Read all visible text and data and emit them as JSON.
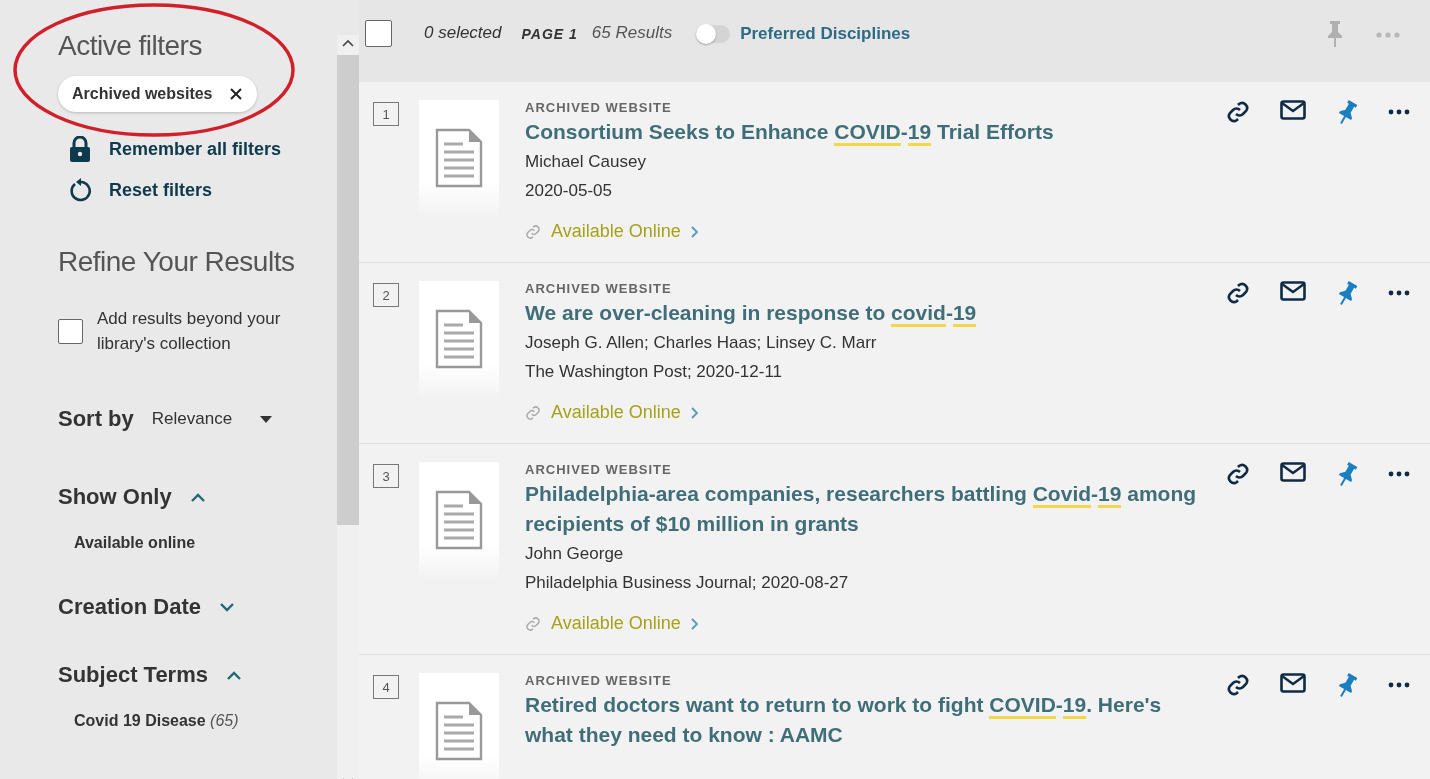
{
  "annotation": {
    "kind": "ellipse",
    "color": "#d0202a"
  },
  "sidebar": {
    "active_filters_title": "Active filters",
    "active_filters": [
      {
        "label": "Archived websites"
      }
    ],
    "remember_filters": "Remember all filters",
    "reset_filters": "Reset filters",
    "refine_title": "Refine Your Results",
    "beyond_collection": {
      "label": "Add results beyond your library's collection",
      "checked": false
    },
    "sort": {
      "label": "Sort by",
      "value": "Relevance"
    },
    "sections": [
      {
        "title": "Show Only",
        "expanded": true,
        "items": [
          {
            "label": "Available online"
          }
        ]
      },
      {
        "title": "Creation Date",
        "expanded": false
      },
      {
        "title": "Subject Terms",
        "expanded": true,
        "items": [
          {
            "label": "Covid 19 Disease",
            "count": "(65)"
          }
        ]
      }
    ]
  },
  "toolbar": {
    "select_all_checked": false,
    "selected": "0 selected",
    "page": "PAGE 1",
    "results": "65 Results",
    "preferred_disciplines": {
      "label": "Preferred Disciplines",
      "on": false
    }
  },
  "results": [
    {
      "number": "1",
      "type": "ARCHIVED WEBSITE",
      "title": [
        {
          "text": "Consortium Seeks to Enhance ",
          "highlight": false
        },
        {
          "text": "COVID",
          "highlight": true
        },
        {
          "text": "-",
          "highlight": false
        },
        {
          "text": "19",
          "highlight": true
        },
        {
          "text": " Trial Efforts",
          "highlight": false
        }
      ],
      "lines": [
        "Michael Causey",
        "2020-05-05"
      ],
      "availability": "Available Online",
      "pinned": true
    },
    {
      "number": "2",
      "type": "ARCHIVED WEBSITE",
      "title": [
        {
          "text": "We are over-cleaning in response to ",
          "highlight": false
        },
        {
          "text": "covid",
          "highlight": true
        },
        {
          "text": "-",
          "highlight": false
        },
        {
          "text": "19",
          "highlight": true
        }
      ],
      "lines": [
        "Joseph G. Allen; Charles Haas; Linsey C. Marr",
        "The Washington Post; 2020-12-11"
      ],
      "availability": "Available Online",
      "pinned": true
    },
    {
      "number": "3",
      "type": "ARCHIVED WEBSITE",
      "title": [
        {
          "text": "Philadelphia-area companies, researchers battling ",
          "highlight": false
        },
        {
          "text": "Covid",
          "highlight": true
        },
        {
          "text": "-",
          "highlight": false
        },
        {
          "text": "19",
          "highlight": true
        },
        {
          "text": " among recipients of $10 million in grants",
          "highlight": false
        }
      ],
      "lines": [
        "John George",
        "Philadelphia Business Journal; 2020-08-27"
      ],
      "availability": "Available Online",
      "pinned": true
    },
    {
      "number": "4",
      "type": "ARCHIVED WEBSITE",
      "title": [
        {
          "text": "Retired doctors want to return to work to fight ",
          "highlight": false
        },
        {
          "text": "COVID",
          "highlight": true
        },
        {
          "text": "-",
          "highlight": false
        },
        {
          "text": "19",
          "highlight": true
        },
        {
          "text": ". Here's what they need to know : AAMC",
          "highlight": false
        }
      ],
      "pinned": true
    }
  ]
}
